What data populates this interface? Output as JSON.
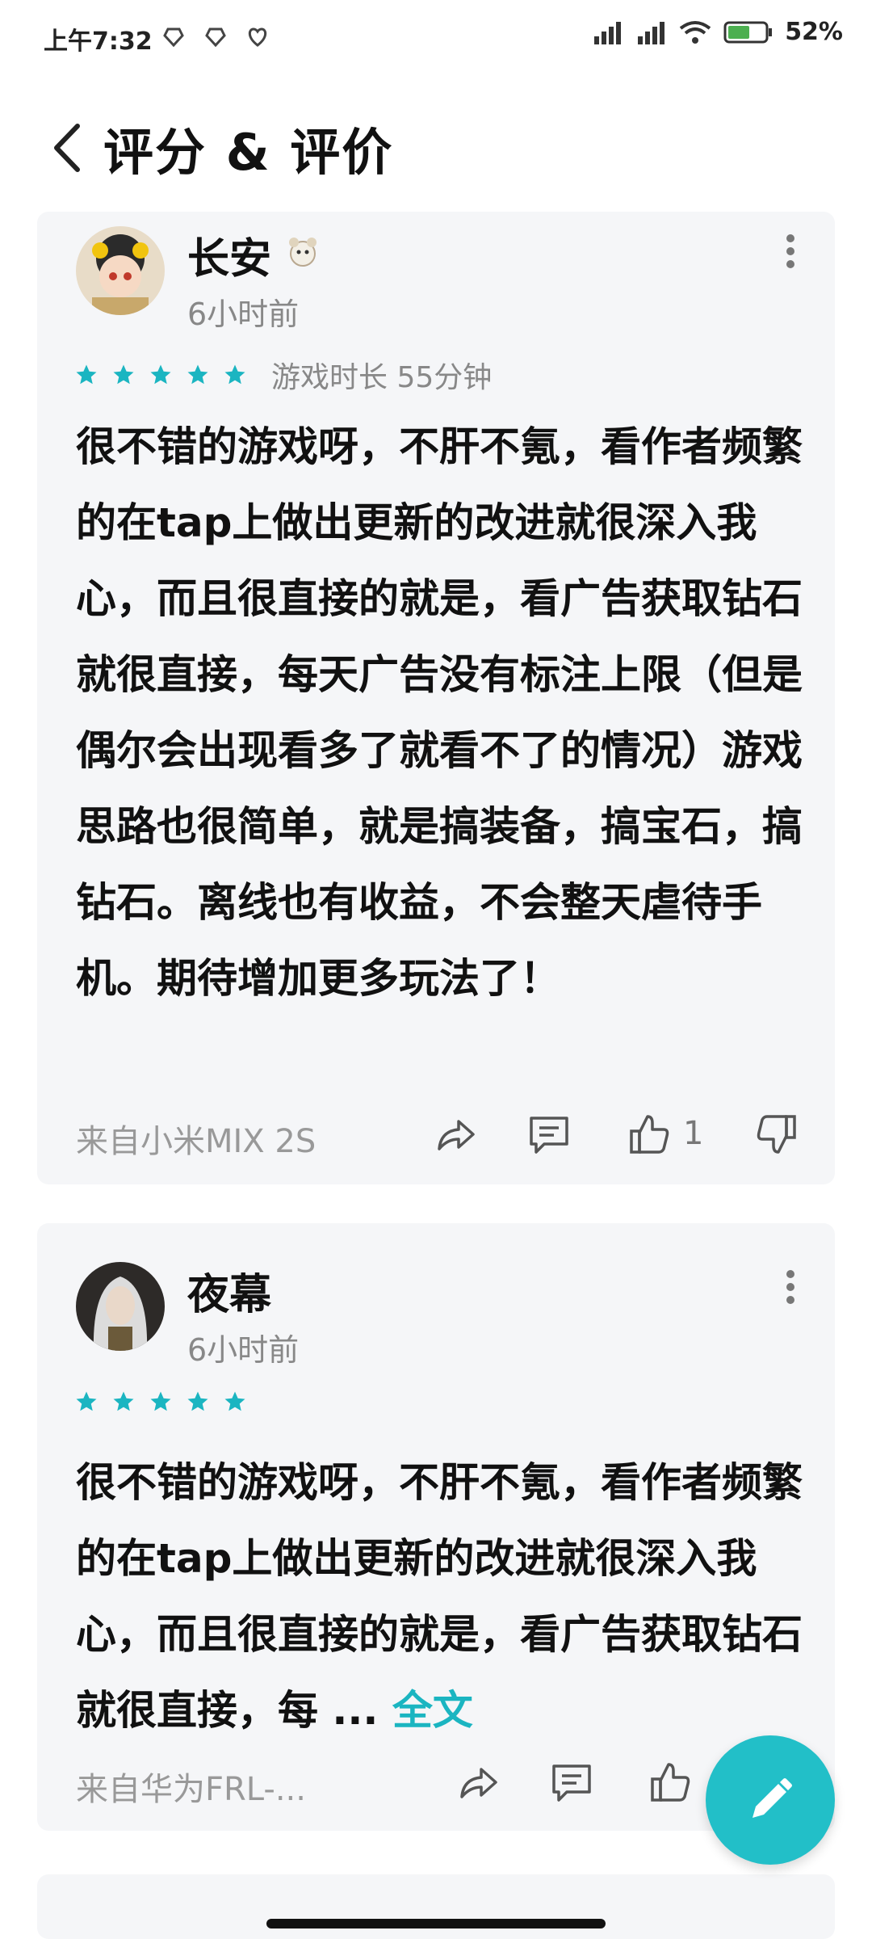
{
  "status_bar": {
    "time": "上午7:32",
    "battery": "52%"
  },
  "header": {
    "title": "评分 & 评价"
  },
  "reviews": [
    {
      "username": "长安",
      "time_ago": "6小时前",
      "rating": 5,
      "playtime": "游戏时长 55分钟",
      "text": "很不错的游戏呀，不肝不氪，看作者频繁的在tap上做出更新的改进就很深入我心，而且很直接的就是，看广告获取钻石就很直接，每天广告没有标注上限（但是偶尔会出现看多了就看不了的情况）游戏思路也很简单，就是搞装备，搞宝石，搞钻石。离线也有收益，不会整天虐待手机。期待增加更多玩法了！",
      "device": "来自小米MIX 2S",
      "likes": "1"
    },
    {
      "username": "夜幕",
      "time_ago": "6小时前",
      "rating": 5,
      "text": "很不错的游戏呀，不肝不氪，看作者频繁的在tap上做出更新的改进就很深入我心，而且很直接的就是，看广告获取钻石就很直接，每 ...",
      "full_text_link": "全文",
      "device": "来自华为FRL-..."
    }
  ],
  "colors": {
    "accent": "#22bfc8",
    "card_bg": "#f5f6f8"
  },
  "icons": [
    "back-icon",
    "more-icon",
    "star-icon",
    "share-icon",
    "comment-icon",
    "thumb-up-icon",
    "thumb-down-icon",
    "edit-icon"
  ]
}
